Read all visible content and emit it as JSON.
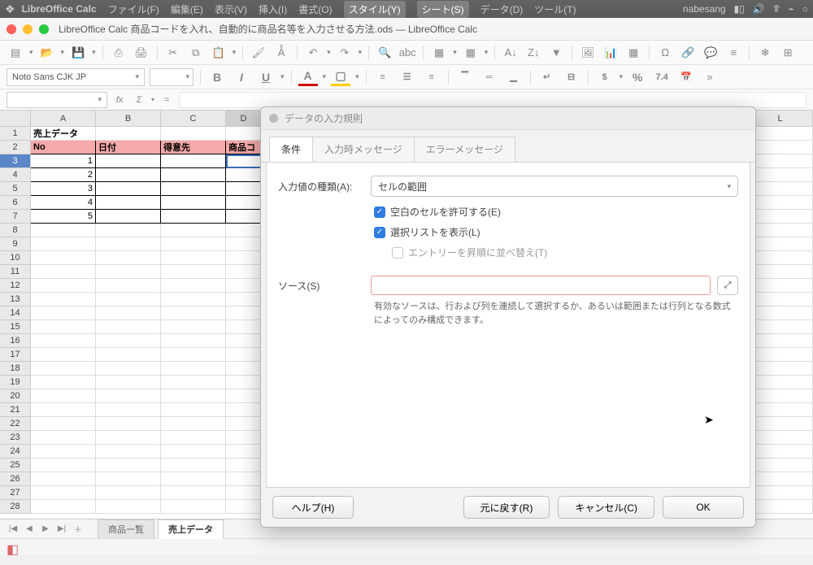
{
  "system_menu": {
    "app": "LibreOffice Calc",
    "items": [
      "ファイル(F)",
      "編集(E)",
      "表示(V)",
      "挿入(I)",
      "書式(O)",
      "スタイル(Y)",
      "シート(S)",
      "データ(D)",
      "ツール(T)"
    ],
    "active_index": 4,
    "user": "nabesang"
  },
  "window_title": "LibreOffice Calc 商品コードを入れ、自動的に商品名等を入力させる方法.ods — LibreOffice Calc",
  "font": {
    "name": "Noto Sans CJK JP",
    "size": ""
  },
  "format_sample": "7.4",
  "percent_sym": "%",
  "name_box": "",
  "columns": [
    "A",
    "B",
    "C",
    "D"
  ],
  "right_column": "L",
  "rows": [
    1,
    2,
    3,
    4,
    5,
    6,
    7,
    8,
    9,
    10,
    11,
    12,
    13,
    14,
    15,
    16,
    17,
    18,
    19,
    20,
    21,
    22,
    23,
    24,
    25,
    26,
    27,
    28
  ],
  "cells": {
    "A1": "売上データ",
    "A2": "No",
    "B2": "日付",
    "C2": "得意先",
    "D2": "商品コ",
    "A3": "1",
    "A4": "2",
    "A5": "3",
    "A6": "4",
    "A7": "5"
  },
  "dialog": {
    "title": "データの入力規則",
    "tabs": [
      "条件",
      "入力時メッセージ",
      "エラーメッセージ"
    ],
    "active_tab": 0,
    "allow_label": "入力値の種類(A):",
    "allow_value": "セルの範囲",
    "cb1": "空白のセルを許可する(E)",
    "cb2": "選択リストを表示(L)",
    "cb3": "エントリーを昇順に並べ替え(T)",
    "source_label": "ソース(S)",
    "source_value": "",
    "hint": "有効なソースは、行および列を連続して選択するか、あるいは範囲または行列となる数式によってのみ構成できます。",
    "btn_help": "ヘルプ(H)",
    "btn_reset": "元に戻す(R)",
    "btn_cancel": "キャンセル(C)",
    "btn_ok": "OK"
  },
  "sheet_tabs": {
    "items": [
      "商品一覧",
      "売上データ"
    ],
    "active": 1
  }
}
